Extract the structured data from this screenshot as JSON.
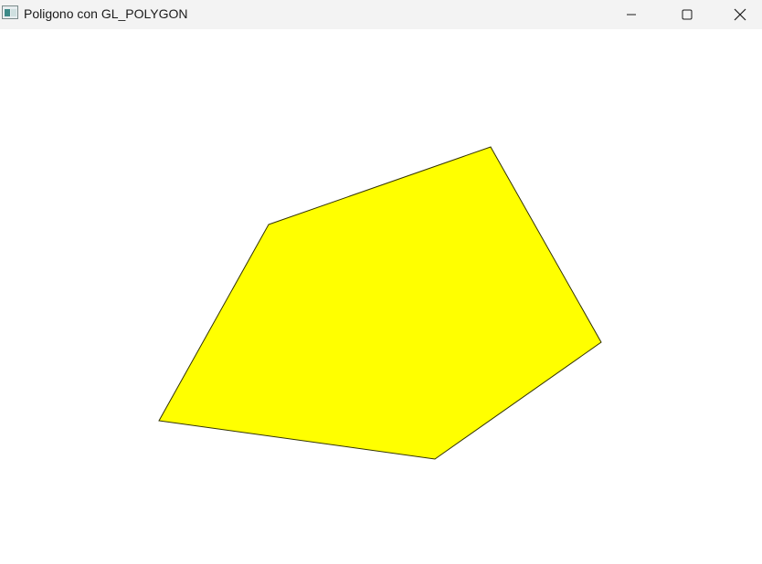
{
  "window": {
    "title": "Poligono con GL_POLYGON"
  },
  "controls": {
    "minimize_icon": "minimize-icon",
    "maximize_icon": "maximize-icon",
    "close_icon": "close-icon"
  },
  "canvas": {
    "background_color": "#ffffff",
    "polygon": {
      "fill_color": "#ffff00",
      "stroke_color": "#333300",
      "vertex_count": 5
    }
  }
}
